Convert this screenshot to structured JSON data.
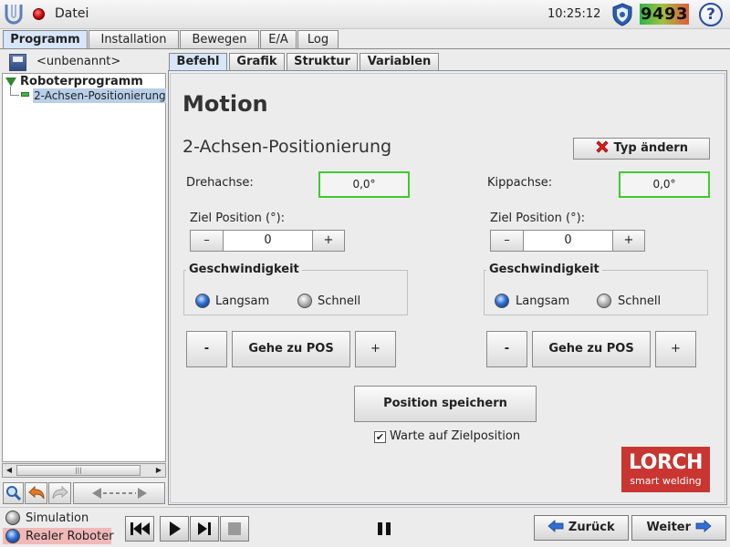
{
  "topbar": {
    "file_label": "Datei",
    "clock": "10:25:12",
    "counter": "9493",
    "help_symbol": "?"
  },
  "main_tabs": [
    "Programm",
    "Installation",
    "Bewegen",
    "E/A",
    "Log"
  ],
  "main_tabs_active": "Programm",
  "left": {
    "program_name": "<unbenannt>",
    "tree_root": "Roboterprogramm",
    "tree_child": "2-Achsen-Positionierung"
  },
  "sub_tabs": [
    "Befehl",
    "Grafik",
    "Struktur",
    "Variablen"
  ],
  "sub_tabs_active": "Befehl",
  "panel": {
    "title": "Motion",
    "subtitle": "2-Achsen-Positionierung",
    "change_type_label": "Typ ändern",
    "left_axis": {
      "label": "Drehachse:",
      "readout": "0,0°",
      "target_label": "Ziel Position (°):",
      "target_value": "0",
      "minus": "–",
      "plus": "+",
      "speed_title": "Geschwindigkeit",
      "slow_label": "Langsam",
      "fast_label": "Schnell",
      "selected_speed": "Langsam",
      "jog_minus": "-",
      "goto_label": "Gehe zu POS",
      "jog_plus": "+"
    },
    "right_axis": {
      "label": "Kippachse:",
      "readout": "0,0°",
      "target_label": "Ziel Position (°):",
      "target_value": "0",
      "minus": "–",
      "plus": "+",
      "speed_title": "Geschwindigkeit",
      "slow_label": "Langsam",
      "fast_label": "Schnell",
      "selected_speed": "Langsam",
      "jog_minus": "-",
      "goto_label": "Gehe zu POS",
      "jog_plus": "+"
    },
    "save_position_label": "Position speichern",
    "wait_checkbox_label": "Warte auf Zielposition",
    "wait_checked": true,
    "logo_top": "LORCH",
    "logo_bottom": "smart welding"
  },
  "bottom": {
    "simulation_label": "Simulation",
    "real_robot_label": "Realer Roboter",
    "back_label": "Zurück",
    "next_label": "Weiter"
  },
  "colors": {
    "accent_blue": "#2f6fd6",
    "readout_border": "#3ecb2e",
    "logo_red": "#c93632",
    "real_robot_highlight": "#f1b8b8"
  }
}
